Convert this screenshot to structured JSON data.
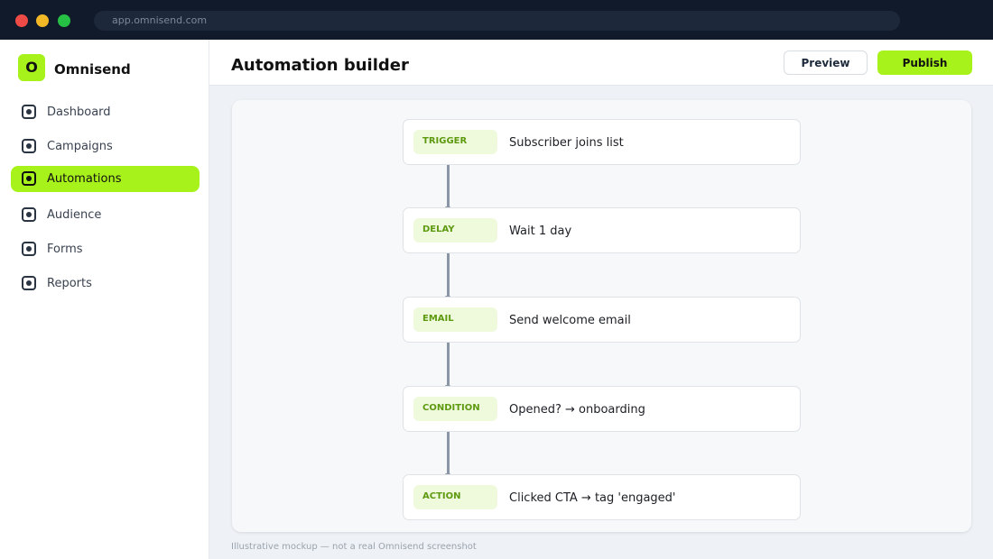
{
  "browser": {
    "url": "app.omnisend.com"
  },
  "sidebar": {
    "logo_letter": "O",
    "brand": "Omnisend",
    "items": [
      {
        "label": "Dashboard"
      },
      {
        "label": "Campaigns"
      },
      {
        "label": "Automations"
      },
      {
        "label": "Audience"
      },
      {
        "label": "Forms"
      },
      {
        "label": "Reports"
      }
    ],
    "active": "Automations"
  },
  "header": {
    "title": "Automation builder",
    "preview_label": "Preview",
    "publish_label": "Publish"
  },
  "flow": {
    "nodes": [
      {
        "tag": "TRIGGER",
        "text": "Subscriber joins list"
      },
      {
        "tag": "DELAY",
        "text": "Wait 1 day"
      },
      {
        "tag": "EMAIL",
        "text": "Send welcome email"
      },
      {
        "tag": "CONDITION",
        "text": "Opened? → onboarding"
      },
      {
        "tag": "ACTION",
        "text": "Clicked CTA → tag 'engaged'"
      }
    ]
  },
  "footnote": "Illustrative mockup — not a real Omnisend screenshot",
  "colors": {
    "accent": "#a8f21c",
    "chrome": "#101a2b",
    "tag_background": "#effadd",
    "tag_text": "#5e9a10"
  }
}
